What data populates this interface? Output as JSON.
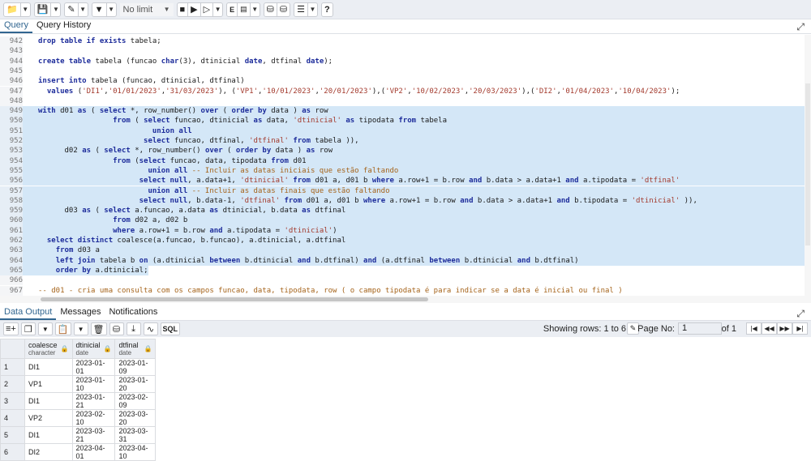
{
  "toolbar": {
    "limit_value": "No limit",
    "icons": [
      "folder-icon",
      "save-icon",
      "pencil-icon",
      "filter-icon",
      "stop-icon",
      "play-icon",
      "play-explain-icon",
      "explain-icon",
      "chart-icon",
      "commit-icon",
      "rollback-icon",
      "macros-icon",
      "help-icon"
    ]
  },
  "tabs": {
    "query": "Query",
    "history": "Query History"
  },
  "editor": {
    "lines": [
      {
        "n": "942",
        "h": "<span class='kw'>drop table if exists</span> tabela;"
      },
      {
        "n": "943",
        "h": ""
      },
      {
        "n": "944",
        "h": "<span class='kw'>create table</span> tabela (funcao <span class='kw'>char</span>(3), dtinicial <span class='kw'>date</span>, dtfinal <span class='kw'>date</span>);"
      },
      {
        "n": "945",
        "h": ""
      },
      {
        "n": "946",
        "h": "<span class='kw'>insert into</span> tabela (funcao, dtinicial, dtfinal)"
      },
      {
        "n": "947",
        "h": "  <span class='kw'>values</span> (<span class='str'>'DI1'</span>,<span class='str'>'01/01/2023'</span>,<span class='str'>'31/03/2023'</span>), (<span class='str'>'VP1'</span>,<span class='str'>'10/01/2023'</span>,<span class='str'>'20/01/2023'</span>),(<span class='str'>'VP2'</span>,<span class='str'>'10/02/2023'</span>,<span class='str'>'20/03/2023'</span>),(<span class='str'>'DI2'</span>,<span class='str'>'01/04/2023'</span>,<span class='str'>'10/04/2023'</span>);"
      },
      {
        "n": "948",
        "h": ""
      },
      {
        "n": "949",
        "h": "<span class='kw'>with</span> d01 <span class='kw'>as</span> ( <span class='kw'>select</span> *, row_number() <span class='kw'>over</span> ( <span class='kw'>order by</span> data ) <span class='kw'>as</span> row",
        "sel": true
      },
      {
        "n": "950",
        "h": "                 <span class='kw'>from</span> ( <span class='kw'>select</span> funcao, dtinicial <span class='kw'>as</span> data, <span class='str'>'dtinicial'</span> <span class='kw'>as</span> tipodata <span class='kw'>from</span> tabela",
        "sel": true
      },
      {
        "n": "951",
        "h": "                          <span class='kw'>union all</span>",
        "sel": true
      },
      {
        "n": "952",
        "h": "                        <span class='kw'>select</span> funcao, dtfinal, <span class='str'>'dtfinal'</span> <span class='kw'>from</span> tabela )),",
        "sel": true
      },
      {
        "n": "953",
        "h": "      d02 <span class='kw'>as</span> ( <span class='kw'>select</span> *, row_number() <span class='kw'>over</span> ( <span class='kw'>order by</span> data ) <span class='kw'>as</span> row",
        "sel": true
      },
      {
        "n": "954",
        "h": "                 <span class='kw'>from</span> (<span class='kw'>select</span> funcao, data, tipodata <span class='kw'>from</span> d01",
        "sel": true
      },
      {
        "n": "955",
        "h": "                         <span class='kw'>union all</span> <span class='cm'>-- Incluir as datas iniciais que estão faltando</span>",
        "sel": true
      },
      {
        "n": "956",
        "h": "                       <span class='kw'>select null</span>, a.data+1, <span class='str'>'dtinicial'</span> <span class='kw'>from</span> d01 a, d01 b <span class='kw'>where</span> a.row+1 = b.row <span class='kw'>and</span> b.data > a.data+1 <span class='kw'>and</span> a.tipodata = <span class='str'>'dtfinal'</span>",
        "sel": true
      },
      {
        "n": "957",
        "h": "                         <span class='kw'>union all</span> <span class='cm'>-- Incluir as datas finais que estão faltando</span>",
        "sel": true
      },
      {
        "n": "958",
        "h": "                       <span class='kw'>select null</span>, b.data-1, <span class='str'>'dtfinal'</span> <span class='kw'>from</span> d01 a, d01 b <span class='kw'>where</span> a.row+1 = b.row <span class='kw'>and</span> b.data > a.data+1 <span class='kw'>and</span> b.tipodata = <span class='str'>'dtinicial'</span> )),",
        "sel": true
      },
      {
        "n": "959",
        "h": "      d03 <span class='kw'>as</span> ( <span class='kw'>select</span> a.funcao, a.data <span class='kw'>as</span> dtinicial, b.data <span class='kw'>as</span> dtfinal",
        "sel": true
      },
      {
        "n": "960",
        "h": "                 <span class='kw'>from</span> d02 a, d02 b",
        "sel": true
      },
      {
        "n": "961",
        "h": "                 <span class='kw'>where</span> a.row+1 = b.row <span class='kw'>and</span> a.tipodata = <span class='str'>'dtinicial'</span>)",
        "sel": true
      },
      {
        "n": "962",
        "h": "  <span class='kw'>select distinct</span> coalesce(a.funcao, b.funcao), a.dtinicial, a.dtfinal",
        "sel": true
      },
      {
        "n": "963",
        "h": "    <span class='kw'>from</span> d03 a",
        "sel": true
      },
      {
        "n": "964",
        "h": "    <span class='kw'>left join</span> tabela b <span class='kw'>on</span> (a.dtinicial <span class='kw'>between</span> b.dtinicial <span class='kw'>and</span> b.dtfinal) <span class='kw'>and</span> (a.dtfinal <span class='kw'>between</span> b.dtinicial <span class='kw'>and</span> b.dtfinal)",
        "sel": true
      },
      {
        "n": "965",
        "h": "    <span class='kw'>order by</span> a.dtinicial;",
        "sel": "partial"
      },
      {
        "n": "966",
        "h": ""
      },
      {
        "n": "967",
        "h": "<span class='cm'>-- d01 - cria uma consulta com os campos funcao, data, tipodata, row ( o campo tipodata é para indicar se a data é inicial ou final )</span>"
      }
    ]
  },
  "output_tabs": {
    "data_output": "Data Output",
    "messages": "Messages",
    "notifications": "Notifications"
  },
  "output_toolbar": {
    "sql_label": "SQL",
    "rows_info": "Showing rows: 1 to 6",
    "page_label": "Page No:",
    "page_value": "1",
    "of_pages": "of 1"
  },
  "grid": {
    "columns": [
      {
        "name": "coalesce",
        "type": "character"
      },
      {
        "name": "dtinicial",
        "type": "date"
      },
      {
        "name": "dtfinal",
        "type": "date"
      }
    ],
    "rows": [
      {
        "n": "1",
        "c": [
          "DI1",
          "2023-01-01",
          "2023-01-09"
        ]
      },
      {
        "n": "2",
        "c": [
          "VP1",
          "2023-01-10",
          "2023-01-20"
        ]
      },
      {
        "n": "3",
        "c": [
          "DI1",
          "2023-01-21",
          "2023-02-09"
        ]
      },
      {
        "n": "4",
        "c": [
          "VP2",
          "2023-02-10",
          "2023-03-20"
        ]
      },
      {
        "n": "5",
        "c": [
          "DI1",
          "2023-03-21",
          "2023-03-31"
        ]
      },
      {
        "n": "6",
        "c": [
          "DI2",
          "2023-04-01",
          "2023-04-10"
        ]
      }
    ]
  }
}
